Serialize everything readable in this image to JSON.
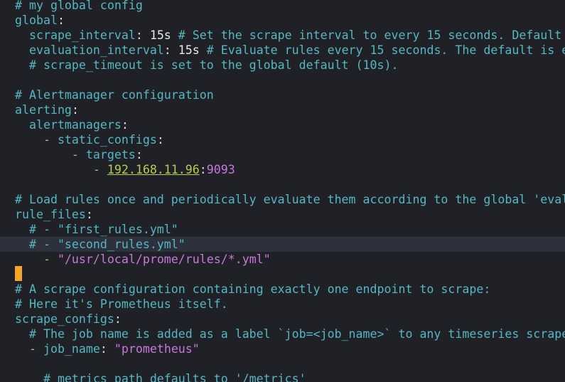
{
  "lines": [
    {
      "segments": [
        {
          "t": "# my global config",
          "k": "c"
        }
      ]
    },
    {
      "segments": [
        {
          "t": "global",
          "k": "k"
        },
        {
          "t": ":",
          "k": "p"
        }
      ]
    },
    {
      "segments": [
        {
          "t": "  scrape_interval",
          "k": "k"
        },
        {
          "t": ": ",
          "k": "p"
        },
        {
          "t": "15s",
          "k": "v"
        },
        {
          "t": " # Set the scrape interval to every 15 seconds. Default",
          "k": "c"
        }
      ]
    },
    {
      "segments": [
        {
          "t": "  evaluation_interval",
          "k": "k"
        },
        {
          "t": ": ",
          "k": "p"
        },
        {
          "t": "15s",
          "k": "v"
        },
        {
          "t": " # Evaluate rules every 15 seconds. The default is e",
          "k": "c"
        }
      ]
    },
    {
      "segments": [
        {
          "t": "  # scrape_timeout is set to the global default (10s).",
          "k": "c"
        }
      ]
    },
    {
      "segments": []
    },
    {
      "segments": [
        {
          "t": "# Alertmanager configuration",
          "k": "c"
        }
      ]
    },
    {
      "segments": [
        {
          "t": "alerting",
          "k": "k"
        },
        {
          "t": ":",
          "k": "p"
        }
      ]
    },
    {
      "segments": [
        {
          "t": "  alertmanagers",
          "k": "k"
        },
        {
          "t": ":",
          "k": "p"
        }
      ]
    },
    {
      "segments": [
        {
          "t": "    - ",
          "k": "d"
        },
        {
          "t": "static_configs",
          "k": "k"
        },
        {
          "t": ":",
          "k": "p"
        }
      ]
    },
    {
      "segments": [
        {
          "t": "        - ",
          "k": "d"
        },
        {
          "t": "targets",
          "k": "k"
        },
        {
          "t": ":",
          "k": "p"
        }
      ]
    },
    {
      "segments": [
        {
          "t": "           - ",
          "k": "d"
        },
        {
          "t": "192.168.11.96",
          "k": "ip"
        },
        {
          "t": ":",
          "k": "p"
        },
        {
          "t": "9093",
          "k": "n"
        }
      ]
    },
    {
      "segments": []
    },
    {
      "segments": [
        {
          "t": "# Load rules once and periodically evaluate them according to the global 'eval",
          "k": "c"
        }
      ]
    },
    {
      "segments": [
        {
          "t": "rule_files",
          "k": "k"
        },
        {
          "t": ":",
          "k": "p"
        }
      ]
    },
    {
      "segments": [
        {
          "t": "  # - \"first_rules.yml\"",
          "k": "c"
        }
      ]
    },
    {
      "segments": [
        {
          "t": "  # - \"second_rules.yml\"",
          "k": "c"
        }
      ],
      "cursorline": true
    },
    {
      "segments": [
        {
          "t": "    - ",
          "k": "d"
        },
        {
          "t": "\"/usr/local/prome/rules/*.yml\"",
          "k": "s"
        }
      ]
    },
    {
      "segments": []
    },
    {
      "segments": [
        {
          "t": "# A scrape configuration containing exactly one endpoint to scrape:",
          "k": "c"
        }
      ]
    },
    {
      "segments": [
        {
          "t": "# Here it's Prometheus itself.",
          "k": "c"
        }
      ]
    },
    {
      "segments": [
        {
          "t": "scrape_configs",
          "k": "k"
        },
        {
          "t": ":",
          "k": "p"
        }
      ]
    },
    {
      "segments": [
        {
          "t": "  # The job name is added as a label `job=<job_name>` to any timeseries scrape",
          "k": "c"
        }
      ]
    },
    {
      "segments": [
        {
          "t": "  - ",
          "k": "d"
        },
        {
          "t": "job_name",
          "k": "k"
        },
        {
          "t": ": ",
          "k": "p"
        },
        {
          "t": "\"prometheus\"",
          "k": "s"
        }
      ]
    },
    {
      "segments": []
    },
    {
      "segments": [
        {
          "t": "    # metrics_path defaults to '/metrics'",
          "k": "c"
        }
      ]
    }
  ],
  "colors": {
    "background": "#1f2126",
    "comment": "#56b6c2",
    "string": "#c678dd",
    "dash": "#98c379",
    "ip_link": "#b8cc52",
    "cursor": "#f5a623",
    "cursorline": "#2c313c"
  }
}
